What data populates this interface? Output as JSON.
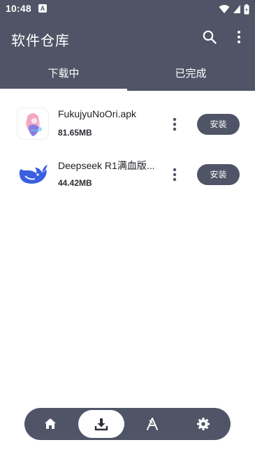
{
  "status": {
    "time": "10:48",
    "notification_icon": "a-icon"
  },
  "appbar": {
    "title": "软件仓库",
    "search_icon": "search-icon",
    "menu_icon": "more-vert-icon"
  },
  "tabs": [
    {
      "label": "下载中",
      "selected": true
    },
    {
      "label": "已完成",
      "selected": false
    }
  ],
  "downloads": [
    {
      "name": "FukujyuNoOri.apk",
      "size": "81.65MB",
      "action": "安装",
      "icon": "anime-girl-app-icon"
    },
    {
      "name": "Deepseek R1满血版...",
      "size": "44.42MB",
      "action": "安装",
      "icon": "deepseek-whale-icon"
    }
  ],
  "bottom_nav": [
    {
      "name": "home",
      "icon": "home-icon",
      "active": false
    },
    {
      "name": "download",
      "icon": "download-icon",
      "active": true
    },
    {
      "name": "apps",
      "icon": "app-store-icon",
      "active": false
    },
    {
      "name": "settings",
      "icon": "settings-icon",
      "active": false
    }
  ],
  "colors": {
    "primary": "#4f5566",
    "surface": "#ffffff",
    "accent": "#3b5fe0"
  }
}
